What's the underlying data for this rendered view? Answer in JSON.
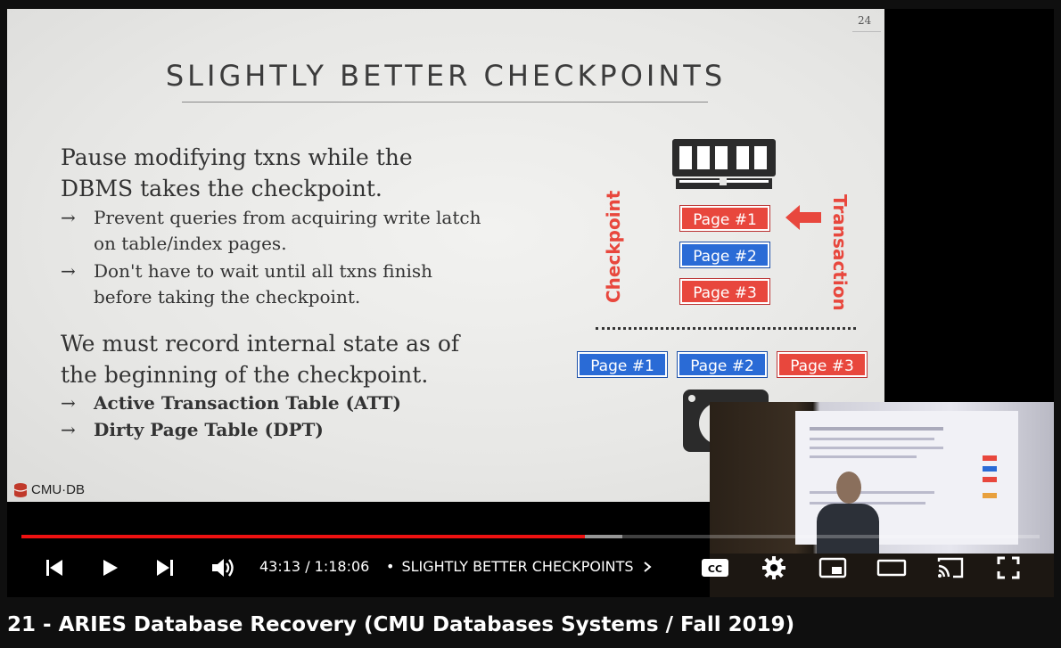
{
  "slide": {
    "page_number": "24",
    "title": "SLIGHTLY BETTER CHECKPOINTS",
    "para1_line1": "Pause modifying txns while the",
    "para1_line2": "DBMS takes the checkpoint.",
    "bullet1_line1": "Prevent queries from acquiring write latch",
    "bullet1_line2": "on table/index pages.",
    "bullet2_line1": "Don't have to wait until all txns finish",
    "bullet2_line2": "before taking the checkpoint.",
    "para2_line1": "We must record internal state as of",
    "para2_line2": "the beginning of the checkpoint.",
    "bullet3": "Active Transaction Table (ATT)",
    "bullet4": "Dirty Page Table (DPT)",
    "arrow": "→",
    "logo_text": "CMU·DB",
    "diagram": {
      "checkpoint_label": "Checkpoint",
      "transaction_label": "Transaction",
      "memory_pages": [
        {
          "label": "Page  #1",
          "color": "red"
        },
        {
          "label": "Page  #2",
          "color": "blue"
        },
        {
          "label": "Page  #3",
          "color": "red"
        }
      ],
      "disk_pages": [
        {
          "label": "Page  #1",
          "color": "blue"
        },
        {
          "label": "Page  #2",
          "color": "blue"
        },
        {
          "label": "Page  #3",
          "color": "red"
        }
      ],
      "icons": [
        "memory-icon",
        "disk-icon",
        "left-arrow-icon"
      ]
    }
  },
  "player": {
    "current_time": "43:13",
    "duration": "1:18:06",
    "time_display": "43:13 / 1:18:06",
    "chapter_separator": "•",
    "chapter": "SLIGHTLY BETTER CHECKPOINTS",
    "progress_fraction": 0.5535,
    "buffer_fraction": 0.59,
    "progress_color": "#ee1111",
    "icons": [
      "previous-icon",
      "play-icon",
      "next-icon",
      "volume-icon",
      "captions-icon",
      "settings-icon",
      "miniplayer-icon",
      "theater-icon",
      "cast-icon",
      "fullscreen-icon",
      "chevron-right-icon"
    ]
  },
  "video_title": "21 - ARIES Database Recovery (CMU Databases Systems / Fall 2019)"
}
